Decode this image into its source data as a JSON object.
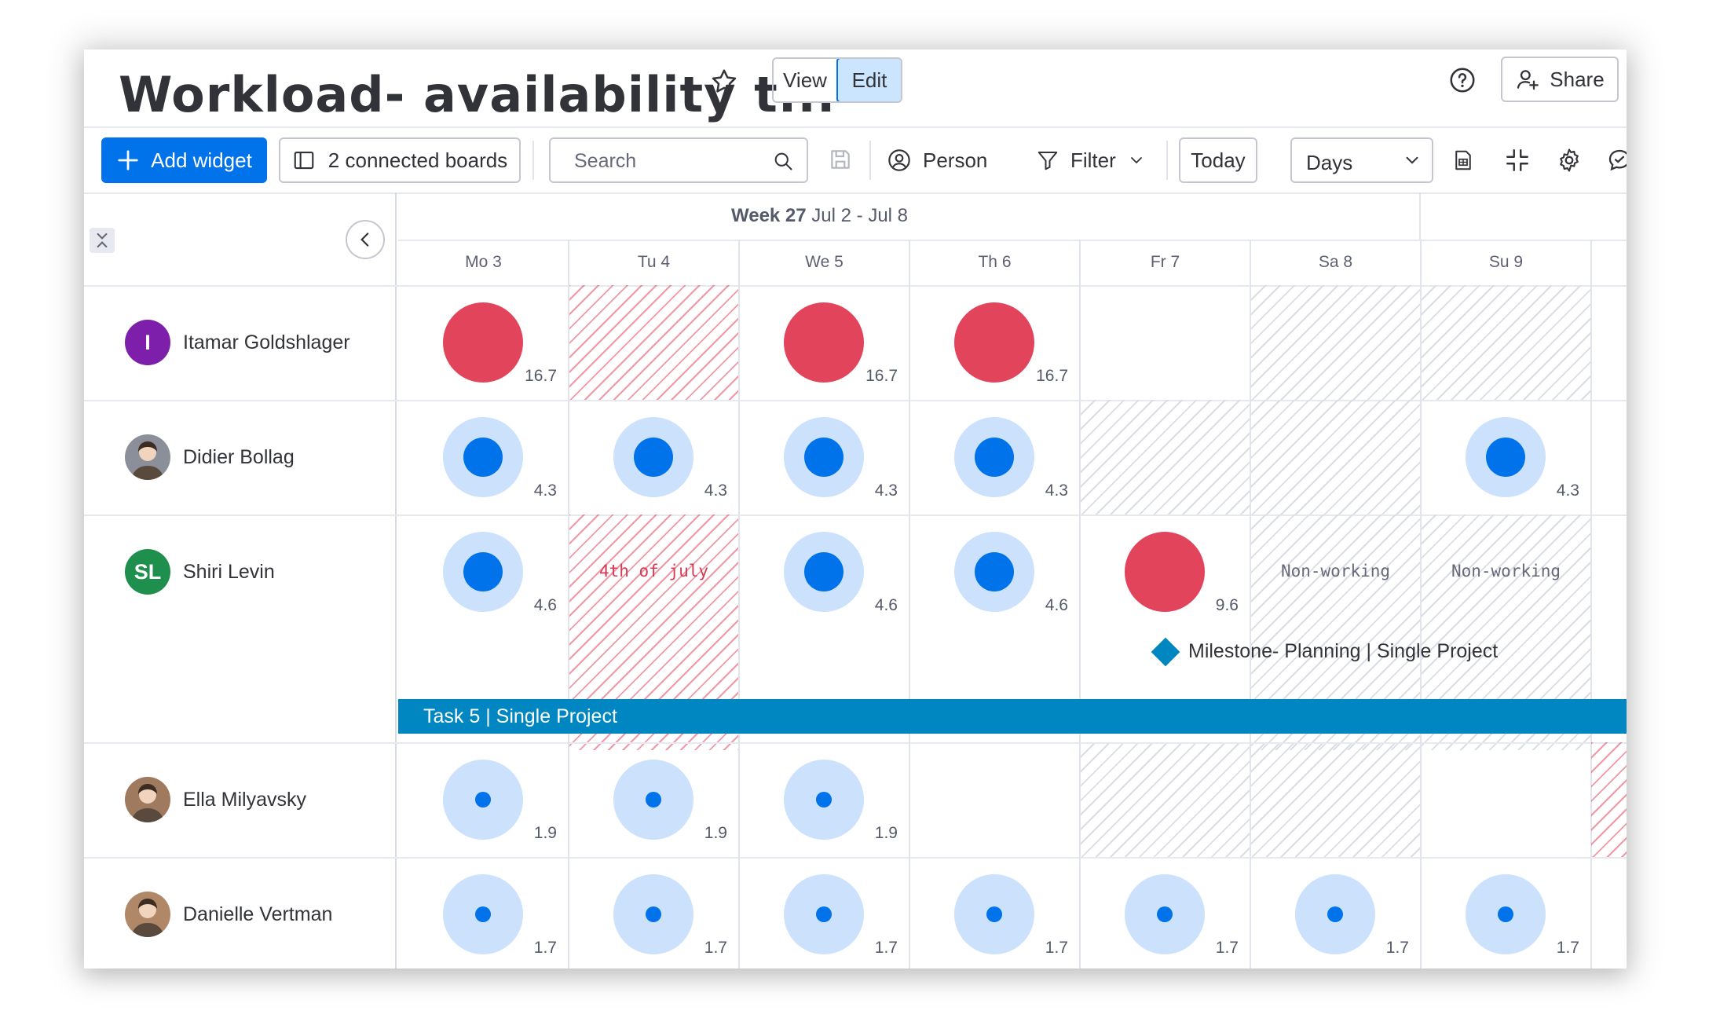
{
  "header": {
    "title": "Workload- availability t...",
    "view_label": "View",
    "edit_label": "Edit",
    "share_label": "Share"
  },
  "toolbar": {
    "add_widget": "Add widget",
    "connected_boards": "2 connected boards",
    "search_placeholder": "Search",
    "person": "Person",
    "filter": "Filter",
    "today": "Today",
    "days": "Days"
  },
  "calendar": {
    "week_bold": "Week 27",
    "week_range": " Jul 2 - Jul 8",
    "days": [
      "Mo 3",
      "Tu 4",
      "We 5",
      "Th 6",
      "Fr 7",
      "Sa 8",
      "Su 9"
    ]
  },
  "people": [
    {
      "name": "Itamar Goldshlager",
      "initial": "I",
      "avatar_color": "#7e1fab",
      "cells": [
        {
          "kind": "over",
          "value": "16.7"
        },
        {
          "kind": "holiday"
        },
        {
          "kind": "over",
          "value": "16.7"
        },
        {
          "kind": "over",
          "value": "16.7"
        },
        {
          "kind": "empty"
        },
        {
          "kind": "weekend"
        },
        {
          "kind": "weekend"
        }
      ]
    },
    {
      "name": "Didier Bollag",
      "initial": "",
      "avatar_color": "#8a8f99",
      "cells": [
        {
          "kind": "load",
          "value": "4.3",
          "level": 0.5
        },
        {
          "kind": "load",
          "value": "4.3",
          "level": 0.5
        },
        {
          "kind": "load",
          "value": "4.3",
          "level": 0.5
        },
        {
          "kind": "load",
          "value": "4.3",
          "level": 0.5
        },
        {
          "kind": "weekend"
        },
        {
          "kind": "weekend"
        },
        {
          "kind": "load",
          "value": "4.3",
          "level": 0.5
        }
      ]
    },
    {
      "name": "Shiri Levin",
      "initial": "SL",
      "avatar_color": "#1f8f4e",
      "cells": [
        {
          "kind": "load",
          "value": "4.6",
          "level": 0.5
        },
        {
          "kind": "holiday",
          "label": "4th of july"
        },
        {
          "kind": "load",
          "value": "4.6",
          "level": 0.5
        },
        {
          "kind": "load",
          "value": "4.6",
          "level": 0.5
        },
        {
          "kind": "over",
          "value": "9.6"
        },
        {
          "kind": "weekend",
          "label": "Non-working"
        },
        {
          "kind": "weekend",
          "label": "Non-working"
        }
      ]
    },
    {
      "name": "Ella Milyavsky",
      "initial": "",
      "avatar_color": "#a07a5f",
      "cells": [
        {
          "kind": "load",
          "value": "1.9",
          "level": 0.2
        },
        {
          "kind": "load",
          "value": "1.9",
          "level": 0.2
        },
        {
          "kind": "load",
          "value": "1.9",
          "level": 0.2
        },
        {
          "kind": "empty"
        },
        {
          "kind": "weekend"
        },
        {
          "kind": "weekend"
        },
        {
          "kind": "empty"
        }
      ]
    },
    {
      "name": "Danielle Vertman",
      "initial": "",
      "avatar_color": "#b08868",
      "cells": [
        {
          "kind": "load",
          "value": "1.7",
          "level": 0.2
        },
        {
          "kind": "load",
          "value": "1.7",
          "level": 0.2
        },
        {
          "kind": "load",
          "value": "1.7",
          "level": 0.2
        },
        {
          "kind": "load",
          "value": "1.7",
          "level": 0.2
        },
        {
          "kind": "load",
          "value": "1.7",
          "level": 0.2
        },
        {
          "kind": "load",
          "value": "1.7",
          "level": 0.2
        },
        {
          "kind": "load",
          "value": "1.7",
          "level": 0.2
        }
      ]
    }
  ],
  "milestone": {
    "label": "Milestone- Planning | Single Project"
  },
  "task_bar": {
    "label": "Task 5 | Single Project"
  },
  "colors": {
    "primary": "#0073ea",
    "over": "#e2445c",
    "light": "#cce1fb",
    "dot": "#0073ea",
    "task_bar": "#0086c0",
    "milestone": "#0086c0"
  }
}
